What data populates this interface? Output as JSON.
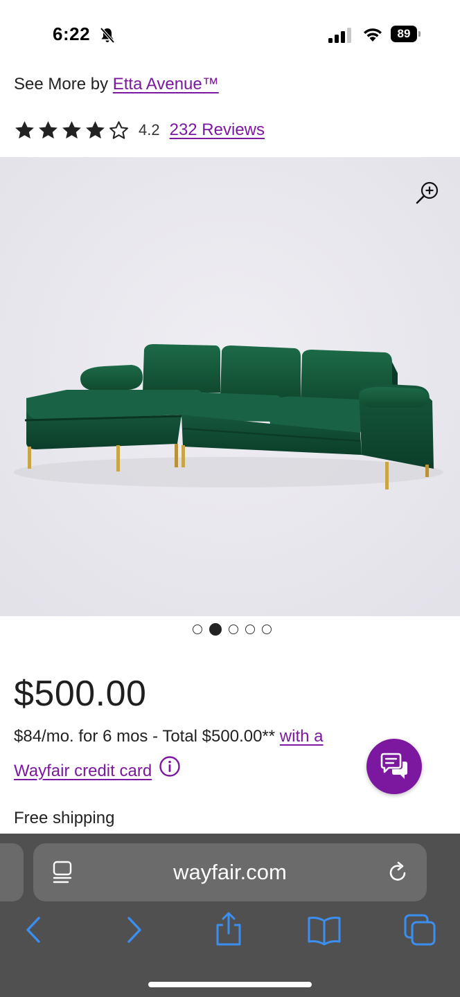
{
  "status_bar": {
    "time": "6:22",
    "battery": "89",
    "icons": [
      "bell-slash-icon",
      "cellular-signal-icon",
      "wifi-icon",
      "battery-icon"
    ]
  },
  "product": {
    "brand_prefix": "See More by ",
    "brand_name": "Etta Avenue™",
    "rating": {
      "value": "4.2",
      "stars_filled": 4,
      "stars_total": 5,
      "reviews_label": "232 Reviews"
    },
    "image": {
      "subject": "green velvet sectional sofa with chaise",
      "sofa_color": "#0f4d33",
      "leg_color": "#c9a545"
    },
    "carousel": {
      "count": 5,
      "active_index": 1
    },
    "price": "$500.00",
    "financing": {
      "text": "$84/mo. for 6 mos - Total $500.00** ",
      "link_part1": "with a",
      "link_part2": "Wayfair credit card"
    },
    "shipping": "Free shipping"
  },
  "browser": {
    "url": "wayfair.com",
    "toolbar_icons": [
      "back-icon",
      "forward-icon",
      "share-icon",
      "bookmarks-icon",
      "tabs-icon"
    ]
  },
  "colors": {
    "accent": "#7b189f",
    "toolbar_blue": "#3b8ff0",
    "safari_bar": "#505050"
  }
}
